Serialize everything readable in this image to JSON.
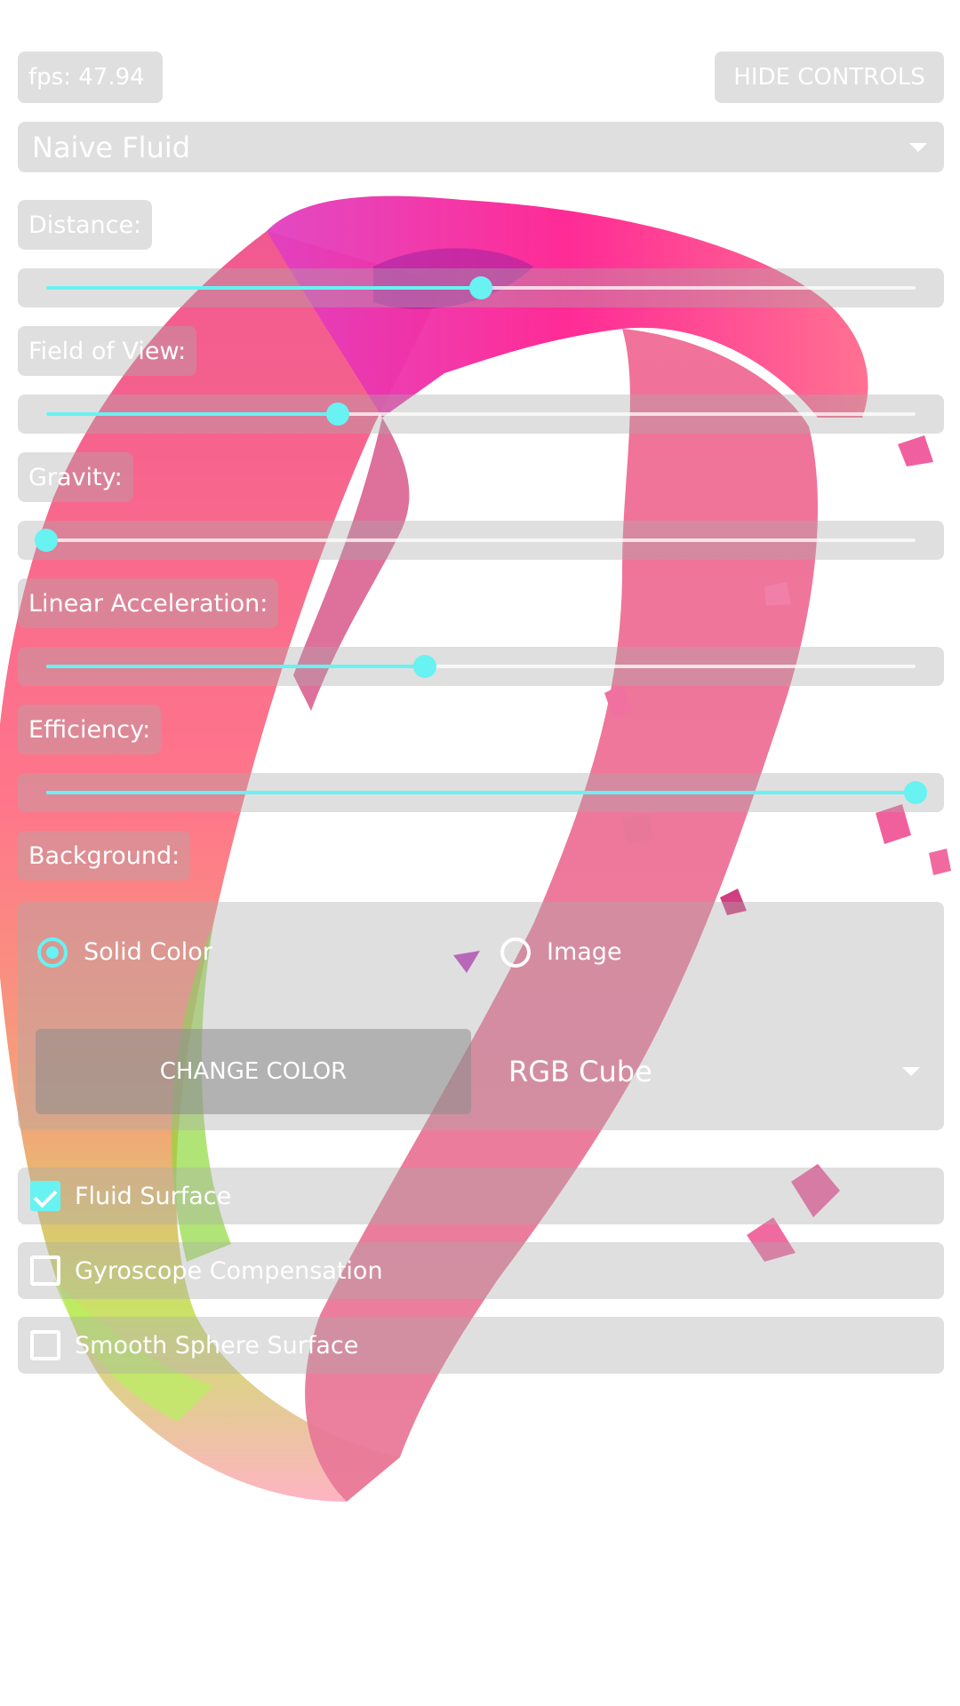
{
  "header": {
    "fps_text": "fps: 47.94",
    "hide_controls_label": "HIDE CONTROLS",
    "mode_select_value": "Naive Fluid"
  },
  "sliders": [
    {
      "label": "Distance:",
      "value": 0.5
    },
    {
      "label": "Field of View:",
      "value": 0.335
    },
    {
      "label": "Gravity:",
      "value": 0.0
    },
    {
      "label": "Linear Acceleration:",
      "value": 0.436
    },
    {
      "label": "Efficiency:",
      "value": 1.0
    }
  ],
  "background": {
    "label": "Background:",
    "options": [
      {
        "label": "Solid Color",
        "checked": true
      },
      {
        "label": "Image",
        "checked": false
      }
    ],
    "change_color_label": "CHANGE COLOR",
    "select_value": "RGB Cube"
  },
  "checkboxes": [
    {
      "label": "Fluid Surface",
      "checked": true
    },
    {
      "label": "Gyroscope Compensation",
      "checked": false
    },
    {
      "label": "Smooth Sphere Surface",
      "checked": false
    }
  ],
  "colors": {
    "accent": "#68f2f2",
    "panel": "#d9d9d9",
    "text": "#ffffff",
    "fluid_main": "#ff6e9c",
    "fluid_highlight": "#ff00a0"
  }
}
